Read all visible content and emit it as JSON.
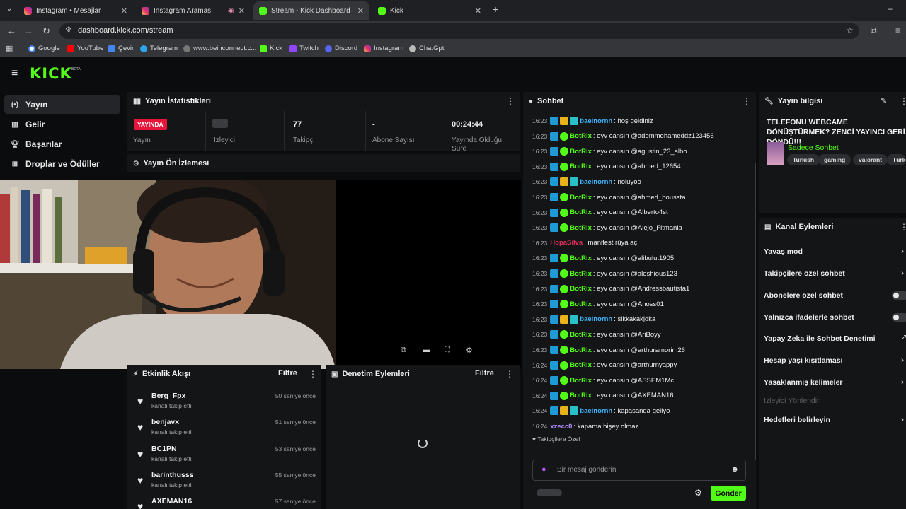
{
  "browser": {
    "tabs": [
      {
        "title": "Instagram • Mesajlar",
        "icon": "instagram-icon"
      },
      {
        "title": "Instagram Araması",
        "icon": "instagram-icon"
      },
      {
        "title": "Stream - Kick Dashboard",
        "icon": "kick-icon"
      },
      {
        "title": "Kick",
        "icon": "kick-icon"
      }
    ],
    "url": "dashboard.kick.com/stream",
    "bookmarks": [
      "Google",
      "YouTube",
      "Çevir",
      "Telegram",
      "www.beinconnect.c...",
      "Kick",
      "Twitch",
      "Discord",
      "Instagram",
      "ChatGpt"
    ]
  },
  "header": {
    "logo": "KICK",
    "beta": "BETA"
  },
  "sidebar": {
    "items": [
      {
        "label": "Yayın",
        "icon": "broadcast-icon"
      },
      {
        "label": "Gelir",
        "icon": "chart-icon"
      },
      {
        "label": "Başarılar",
        "icon": "trophy-icon"
      },
      {
        "label": "Droplar ve Ödüller",
        "icon": "gift-icon"
      }
    ]
  },
  "stats_panel": {
    "title": "Yayın İstatistikleri",
    "live_badge": "YAYINDA",
    "stats": [
      {
        "value": "",
        "label": "Yayın"
      },
      {
        "value": "",
        "label": "İzleyici"
      },
      {
        "value": "77",
        "label": "Takipçi"
      },
      {
        "value": "-",
        "label": "Abone Sayısı"
      },
      {
        "value": "00:24:44",
        "label": "Yayında Olduğu Süre"
      }
    ]
  },
  "preview_panel": {
    "title": "Yayın Ön İzlemesi"
  },
  "activity_panel": {
    "title": "Etkinlik Akışı",
    "filter": "Filtre",
    "items": [
      {
        "name": "Berg_Fpx",
        "sub": "kanalı takip etti",
        "time": "50 saniye önce"
      },
      {
        "name": "benjavx",
        "sub": "kanalı takip etti",
        "time": "51 saniye önce"
      },
      {
        "name": "BC1PN",
        "sub": "kanalı takip etti",
        "time": "53 saniye önce"
      },
      {
        "name": "barinthusss",
        "sub": "kanalı takip etti",
        "time": "55 saniye önce"
      },
      {
        "name": "AXEMAN16",
        "sub": "",
        "time": "57 saniye önce"
      }
    ]
  },
  "moderation_panel": {
    "title": "Denetim Eylemleri",
    "filter": "Filtre"
  },
  "chat": {
    "title": "Sohbet",
    "messages": [
      {
        "time": "16:23",
        "user": "baelnornn",
        "color": "#3fb6ff",
        "badges": [
          "b-mod",
          "b-crown",
          "b-sub"
        ],
        "text": ": hoş geldiniz"
      },
      {
        "time": "16:23",
        "user": "BotRix",
        "color": "#53fc18",
        "badges": [
          "b-mod",
          "b-ver"
        ],
        "text": ": eyv cansın @ademmohameddz123456"
      },
      {
        "time": "16:23",
        "user": "BotRix",
        "color": "#53fc18",
        "badges": [
          "b-mod",
          "b-ver"
        ],
        "text": ": eyv cansın @agustin_23_albo"
      },
      {
        "time": "16:23",
        "user": "BotRix",
        "color": "#53fc18",
        "badges": [
          "b-mod",
          "b-ver"
        ],
        "text": ": eyv cansın @ahmed_12654"
      },
      {
        "time": "16:23",
        "user": "baelnornn",
        "color": "#3fb6ff",
        "badges": [
          "b-mod",
          "b-crown",
          "b-sub"
        ],
        "text": ": noluyoo"
      },
      {
        "time": "16:23",
        "user": "BotRix",
        "color": "#53fc18",
        "badges": [
          "b-mod",
          "b-ver"
        ],
        "text": ": eyv cansın @ahmed_boussta"
      },
      {
        "time": "16:23",
        "user": "BotRix",
        "color": "#53fc18",
        "badges": [
          "b-mod",
          "b-ver"
        ],
        "text": ": eyv cansın @Alberto4st"
      },
      {
        "time": "16:23",
        "user": "BotRix",
        "color": "#53fc18",
        "badges": [
          "b-mod",
          "b-ver"
        ],
        "text": ": eyv cansın @Alejo_Fitmania"
      },
      {
        "time": "16:23",
        "user": "HopaSilva",
        "color": "#e02d5a",
        "badges": [],
        "text": ": manifest rüya aç"
      },
      {
        "time": "16:23",
        "user": "BotRix",
        "color": "#53fc18",
        "badges": [
          "b-mod",
          "b-ver"
        ],
        "text": ": eyv cansın @alibulut1905"
      },
      {
        "time": "16:23",
        "user": "BotRix",
        "color": "#53fc18",
        "badges": [
          "b-mod",
          "b-ver"
        ],
        "text": ": eyv cansın @aloshious123"
      },
      {
        "time": "16:23",
        "user": "BotRix",
        "color": "#53fc18",
        "badges": [
          "b-mod",
          "b-ver"
        ],
        "text": ": eyv cansın @Andressbautista1"
      },
      {
        "time": "16:23",
        "user": "BotRix",
        "color": "#53fc18",
        "badges": [
          "b-mod",
          "b-ver"
        ],
        "text": ": eyv cansın @Anoss01"
      },
      {
        "time": "16:23",
        "user": "baelnornn",
        "color": "#3fb6ff",
        "badges": [
          "b-mod",
          "b-crown",
          "b-sub"
        ],
        "text": ": slkkakakjdka"
      },
      {
        "time": "16:23",
        "user": "BotRix",
        "color": "#53fc18",
        "badges": [
          "b-mod",
          "b-ver"
        ],
        "text": ": eyv cansın @AriBoyy"
      },
      {
        "time": "16:23",
        "user": "BotRix",
        "color": "#53fc18",
        "badges": [
          "b-mod",
          "b-ver"
        ],
        "text": ": eyv cansın @arthuramorim26"
      },
      {
        "time": "16:24",
        "user": "BotRix",
        "color": "#53fc18",
        "badges": [
          "b-mod",
          "b-ver"
        ],
        "text": ": eyv cansın @arthurnyappy"
      },
      {
        "time": "16:24",
        "user": "BotRix",
        "color": "#53fc18",
        "badges": [
          "b-mod",
          "b-ver"
        ],
        "text": ": eyv cansın @ASSEM1Mc"
      },
      {
        "time": "16:24",
        "user": "BotRix",
        "color": "#53fc18",
        "badges": [
          "b-mod",
          "b-ver"
        ],
        "text": ": eyv cansın @AXEMAN16"
      },
      {
        "time": "16:24",
        "user": "baelnornn",
        "color": "#3fb6ff",
        "badges": [
          "b-mod",
          "b-crown",
          "b-sub"
        ],
        "text": ": kapasanda geliyo"
      },
      {
        "time": "16:24",
        "user": "xzecc0",
        "color": "#b48cff",
        "badges": [],
        "text": ": kapama bişey olmaz"
      }
    ],
    "followers_only": "Takipçilere Özel",
    "input_placeholder": "Bir mesaj gönderin",
    "send_label": "Gönder"
  },
  "stream_info": {
    "title": "Yayın bilgisi",
    "stream_title": "TELEFONU WEBCAME DÖNÜŞTÜRMEK? ZENCİ YAYINCI GERİ DÖNDÜ!!!",
    "category": "Sadece Sohbet",
    "tags": [
      "Turkish",
      "gaming",
      "valorant",
      "Türk"
    ]
  },
  "channel_actions": {
    "title": "Kanal Eylemleri",
    "items": [
      {
        "label": "Yavaş mod",
        "control": "chevron"
      },
      {
        "label": "Takipçilere özel sohbet",
        "control": "chevron"
      },
      {
        "label": "Abonelere özel sohbet",
        "control": "toggle"
      },
      {
        "label": "Yalnızca ifadelerle sohbet",
        "control": "toggle"
      },
      {
        "label": "Yapay Zeka ile Sohbet Denetimi",
        "control": "external"
      },
      {
        "label": "Hesap yaşı kısıtlaması",
        "control": "chevron"
      },
      {
        "label": "Yasaklanmış kelimeler",
        "control": "chevron"
      },
      {
        "label": "İzleyici Yönlendir",
        "control": "none"
      },
      {
        "label": "Hedefleri belirleyin",
        "control": "chevron"
      }
    ]
  }
}
